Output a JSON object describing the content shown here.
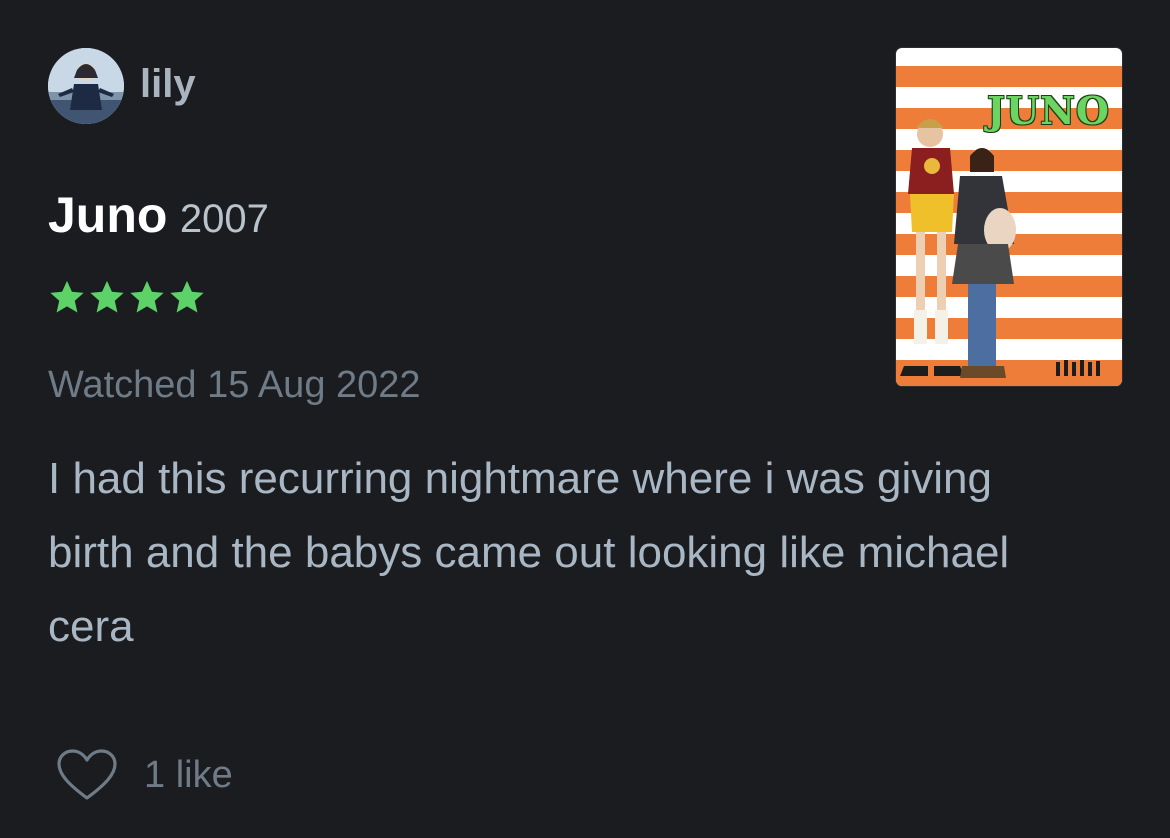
{
  "user": {
    "name": "lily",
    "avatar_icon": "user-avatar-photo"
  },
  "film": {
    "title": "Juno",
    "year": "2007",
    "poster_title": "JUNO"
  },
  "rating": {
    "value": 4,
    "max": 5,
    "color": "#5cd268"
  },
  "watched": "Watched 15 Aug 2022",
  "review_text": "I had this recurring nightmare where i was giving birth and the babys came out looking like michael cera",
  "likes": {
    "label": "1 like",
    "icon": "heart-outline-icon"
  },
  "colors": {
    "background": "#1a1c20",
    "poster_stripe_orange": "#ee7d3a",
    "poster_stripe_white": "#ffffff"
  }
}
